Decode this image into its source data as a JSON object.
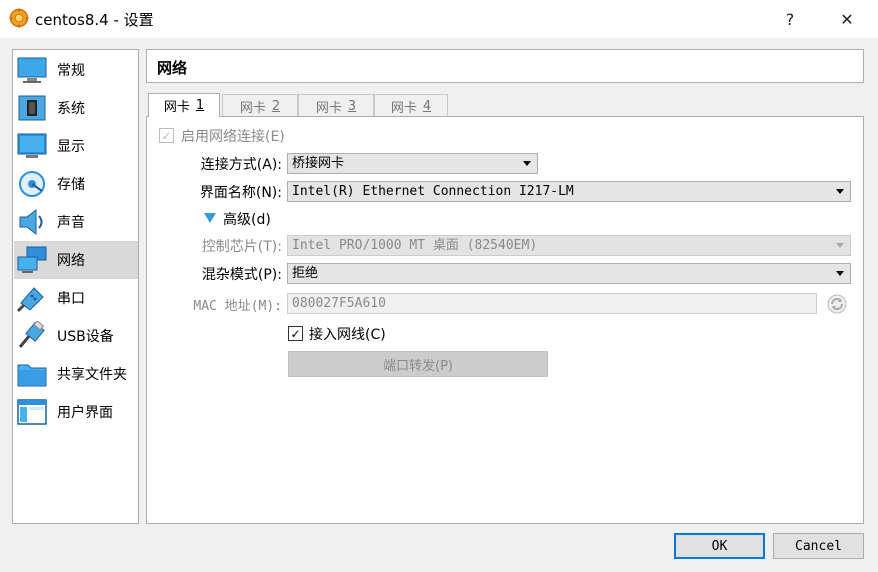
{
  "window": {
    "title": "centos8.4 - 设置",
    "help": "?",
    "close": "✕"
  },
  "sidebar": {
    "items": [
      {
        "label": "常规",
        "icon": "general-icon"
      },
      {
        "label": "系统",
        "icon": "system-icon"
      },
      {
        "label": "显示",
        "icon": "display-icon"
      },
      {
        "label": "存储",
        "icon": "storage-icon"
      },
      {
        "label": "声音",
        "icon": "audio-icon"
      },
      {
        "label": "网络",
        "icon": "network-icon",
        "selected": true
      },
      {
        "label": "串口",
        "icon": "serial-port-icon"
      },
      {
        "label": "USB设备",
        "icon": "usb-icon"
      },
      {
        "label": "共享文件夹",
        "icon": "shared-folder-icon"
      },
      {
        "label": "用户界面",
        "icon": "user-interface-icon"
      }
    ]
  },
  "section": {
    "title": "网络"
  },
  "tabs": [
    {
      "label": "网卡",
      "num": "1",
      "active": true
    },
    {
      "label": "网卡",
      "num": "2"
    },
    {
      "label": "网卡",
      "num": "3"
    },
    {
      "label": "网卡",
      "num": "4"
    }
  ],
  "form": {
    "enable_adapter": "启用网络连接(E)",
    "attached_to_label": "连接方式(A):",
    "attached_to_value": "桥接网卡",
    "name_label": "界面名称(N):",
    "name_value": "Intel(R) Ethernet Connection I217-LM",
    "advanced": "高级(d)",
    "adapter_type_label": "控制芯片(T):",
    "adapter_type_value": "Intel PRO/1000 MT 桌面 (82540EM)",
    "promiscuous_label": "混杂模式(P):",
    "promiscuous_value": "拒绝",
    "mac_label": "MAC 地址(M):",
    "mac_value": "080027F5A610",
    "cable_connected": "接入网线(C)",
    "port_forwarding": "端口转发(P)"
  },
  "buttons": {
    "ok": "OK",
    "cancel": "Cancel"
  },
  "colors": {
    "selected_bg": "#d9d9d9",
    "accent": "#0078d7"
  }
}
